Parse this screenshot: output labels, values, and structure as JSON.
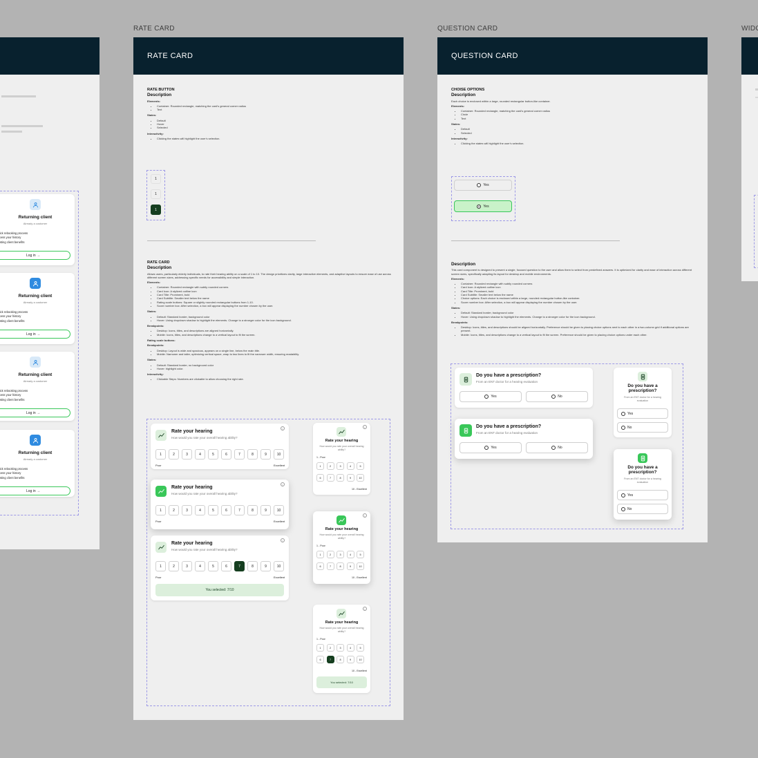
{
  "frames": {
    "rate_card": {
      "label": "RATE CARD",
      "header": "RATE CARD"
    },
    "question_card": {
      "label": "QUESTION CARD",
      "header": "QUESTION CARD"
    },
    "widget": {
      "label": "WIDG"
    }
  },
  "rate_doc": {
    "section1_title": "RATE BUTTON",
    "desc_heading": "Description",
    "elements_label": "Elements:",
    "elements": [
      "Container: Rounded rectangle, matching the card's general corner radius",
      "Text"
    ],
    "states_label": "States:",
    "states": [
      "Default",
      "Hover",
      "Selected"
    ],
    "interactivity_label": "Interactivity:",
    "interactivity": [
      "Clicking the states will highlight the user's selection."
    ],
    "buttons": [
      "1",
      "1",
      "1"
    ],
    "section2_title": "RATE CARD",
    "desc2_heading": "Description",
    "intro": "Allows users, particularly elderly individuals, to rate their hearing ability on a scale of 1 to 10. The design prioritizes clarity, large interactive elements, and adaptive layouts to ensure ease of use across different screen sizes, addressing specific needs for accessibility and simple interaction.",
    "elements2": [
      "Container: Rounded rectangle with subtly rounded corners",
      "Card Icon: A stylized outline icon",
      "Card Title: Prominent, bold",
      "Card Subtitle: Smaller text below the name",
      "Rating scale buttons: Square or slightly rounded rectangular buttons from 1-10.",
      "Score number box: After selection, a box will appear displaying the number chosen by the user."
    ],
    "states2": [
      "Default: Standard border, background color",
      "Hover: Using dropdown shadow to highlight the elements. Change to a stronger color for the icon background."
    ],
    "breakpoints_label": "Breakpoints:",
    "breakpoints": [
      "Desktop: Icons, titles, and descriptions are aligned horizontally.",
      "Mobile: Icons, titles, and descriptions change to a vertical layout to fit the screen."
    ],
    "rating_label": "Rating scale buttons:",
    "rating_breakpoints": [
      "Desktop: Layout is wide and spacious, appears on a single line, below the main title.",
      "Mobile: Narrower and taller, optimizing vertical space, wrap to two lines to fit the narrower width, ensuring readability."
    ],
    "rating_states": [
      "Default: Standard border, no background color",
      "Hover: highlight color."
    ],
    "rating_interactivity": [
      "Clickable Steps: Numbers are clickable to allow choosing the right rate."
    ]
  },
  "rate_cards": {
    "title": "Rate your hearing",
    "subtitle": "How would you rate your overall hearing ability?",
    "poor": "Poor",
    "excellent": "Excellent",
    "poor_m": "1 - Poor",
    "excellent_m": "10 - Excellent",
    "result": "You selected: 7/10",
    "info": "i",
    "scale": [
      "1",
      "2",
      "3",
      "4",
      "5",
      "6",
      "7",
      "8",
      "9",
      "10"
    ]
  },
  "question_doc": {
    "section1_title": "CHOISE OPTIONS",
    "desc_heading": "Description",
    "intro1": "Each choice is enclosed within a large, rounded rectangular button-like container.",
    "elements_label": "Elements:",
    "elements": [
      "Container: Rounded rectangle, matching the card's general corner radius",
      "Circle",
      "Text"
    ],
    "states_label": "States:",
    "states": [
      "Default",
      "Selected"
    ],
    "interactivity_label": "Interactivity:",
    "interactivity": [
      "Clicking the states will highlight the user's selection."
    ],
    "option_yes": "Yes",
    "desc2_heading": "Description",
    "intro2": "This card component is designed to present a single, focused question to the user and allow them to select from predefined answers. It is optimized for clarity and ease of interaction across different screen sizes, specifically adapting its layout for desktop and mobile environments.",
    "elements2": [
      "Container: Rounded rectangle with subtly rounded corners",
      "Card Icon: A stylized outline icon",
      "Card Title: Prominent, bold",
      "Card Subtitle: Smaller text below the name",
      "Choice options: Each choice is enclosed within a large, rounded rectangular button-like container.",
      "Score number box: After selection, a box will appear displaying the number chosen by the user."
    ],
    "states2": [
      "Default: Standard border, background color",
      "Hover: Using dropdown shadow to highlight the elements. Change to a stronger color for the icon background."
    ],
    "breakpoints_label": "Breakpoints:",
    "breakpoints": [
      "Desktop: Icons, titles, and descriptions should be aligned horizontally. Preference should be given to placing choice options next to each other in a two-column grid if additional options are present.",
      "Mobile: Icons, titles, and descriptions change to a vertical layout to fit the screen. Preference should be given to placing choice options under each other."
    ]
  },
  "question_cards": {
    "title": "Do you have a prescription?",
    "subtitle": "From an ENT doctor for a hearing evaluation",
    "yes": "Yes",
    "no": "No"
  },
  "client_cards": {
    "title": "Returning client",
    "subtitle": "Already a customer",
    "benefits": [
      "Quick rebooking process",
      "Access your history",
      "Existing client benefits"
    ],
    "login": "Log in →"
  },
  "colors": {
    "header": "#08212e",
    "accent_green": "#39c759",
    "selected_dark": "#153e1f",
    "accent_blue": "#2f8be0"
  }
}
